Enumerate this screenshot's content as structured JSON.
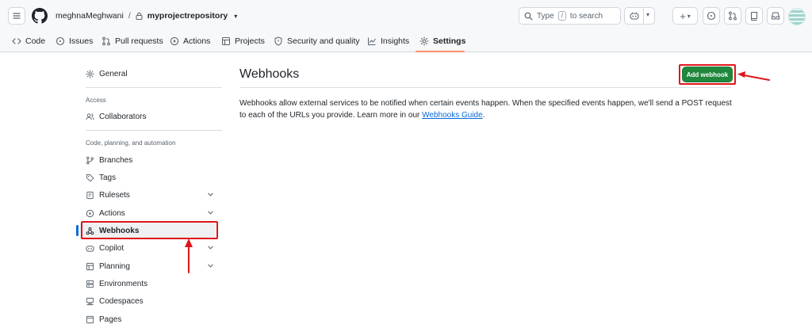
{
  "header": {
    "owner": "meghnaMeghwani",
    "separator": "/",
    "repo": "myprojectrepository",
    "search_label": "Type",
    "search_key": "/",
    "search_suffix": "to search"
  },
  "tabs": [
    {
      "label": "Code",
      "icon": "code-icon"
    },
    {
      "label": "Issues",
      "icon": "issue-icon"
    },
    {
      "label": "Pull requests",
      "icon": "pull-request-icon"
    },
    {
      "label": "Actions",
      "icon": "play-icon"
    },
    {
      "label": "Projects",
      "icon": "table-icon"
    },
    {
      "label": "Security and quality",
      "icon": "shield-icon"
    },
    {
      "label": "Insights",
      "icon": "graph-icon"
    },
    {
      "label": "Settings",
      "icon": "gear-icon",
      "active": true
    }
  ],
  "sidebar": {
    "general": "General",
    "access_heading": "Access",
    "collaborators": "Collaborators",
    "code_heading": "Code, planning, and automation",
    "items": [
      {
        "label": "Branches",
        "icon": "branch-icon",
        "expandable": false
      },
      {
        "label": "Tags",
        "icon": "tag-icon",
        "expandable": false
      },
      {
        "label": "Rulesets",
        "icon": "ruleset-icon",
        "expandable": true
      },
      {
        "label": "Actions",
        "icon": "play-icon",
        "expandable": true
      },
      {
        "label": "Webhooks",
        "icon": "webhook-icon",
        "expandable": false,
        "active": true
      },
      {
        "label": "Copilot",
        "icon": "copilot-icon",
        "expandable": true
      },
      {
        "label": "Planning",
        "icon": "table-icon",
        "expandable": true
      },
      {
        "label": "Environments",
        "icon": "server-icon",
        "expandable": false
      },
      {
        "label": "Codespaces",
        "icon": "codespaces-icon",
        "expandable": false
      },
      {
        "label": "Pages",
        "icon": "browser-icon",
        "expandable": false
      }
    ]
  },
  "main": {
    "title": "Webhooks",
    "add_button": "Add webhook",
    "description": "Webhooks allow external services to be notified when certain events happen. When the specified events happen, we'll send a POST request to each of the URLs you provide. Learn more in our",
    "link_text": "Webhooks Guide",
    "link_suffix": "."
  },
  "colors": {
    "primary_button": "#1f883d",
    "link": "#0969da",
    "active_indicator": "#0969da",
    "tab_underline": "#fd8c73",
    "annotation_red": "#e0161b"
  }
}
